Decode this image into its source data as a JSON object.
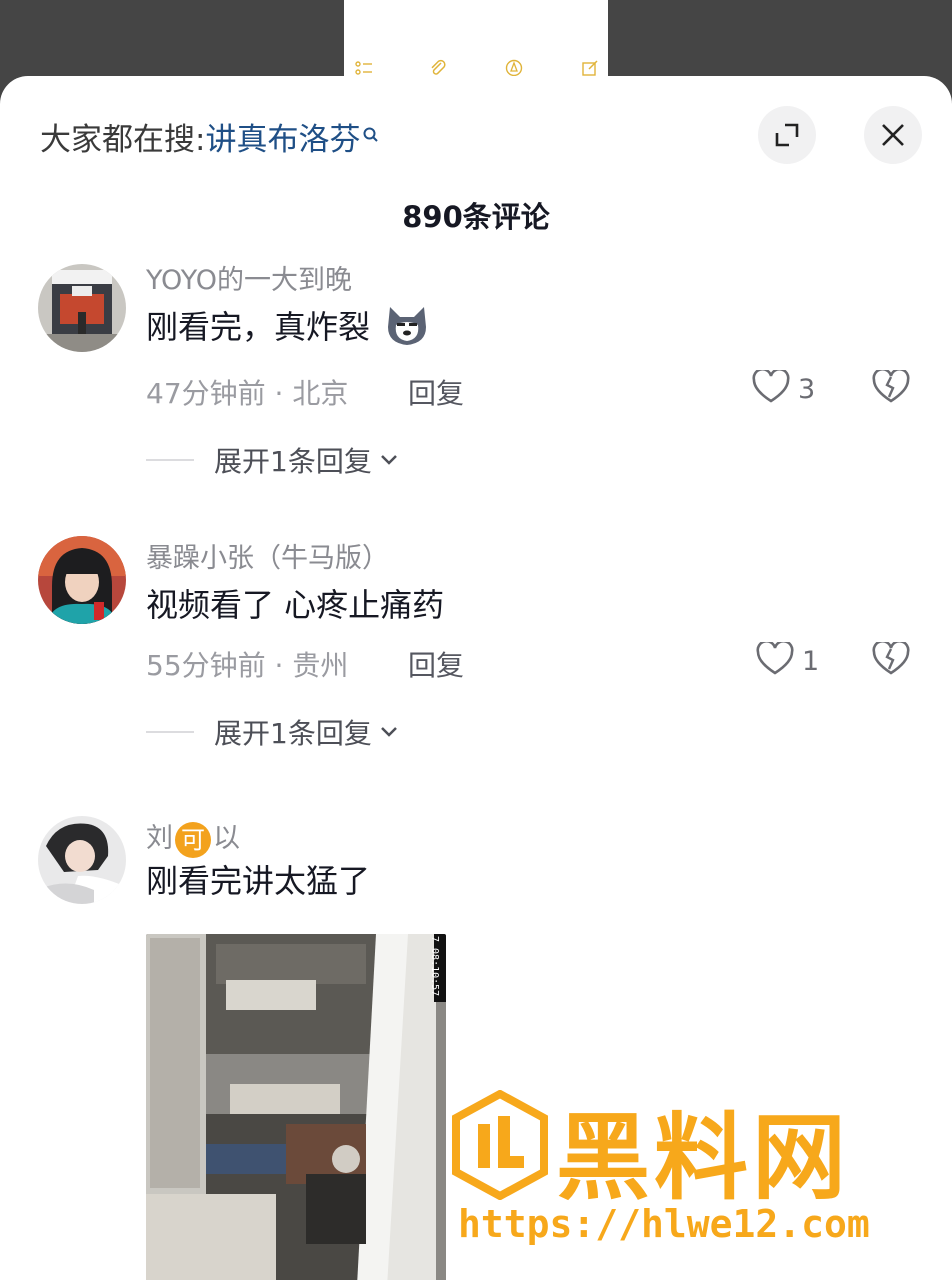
{
  "notes_toolbar": {
    "icons": [
      "checklist-icon",
      "paperclip-icon",
      "pen-icon",
      "compose-icon"
    ]
  },
  "header": {
    "search_prefix": "大家都在搜:",
    "search_keyword": "讲真布洛芬",
    "comment_count_title": "890条评论"
  },
  "comments": [
    {
      "username": "YOYO的一大到晚",
      "text": "刚看完，真炸裂",
      "emoji": "husky-emoji",
      "time_location": "47分钟前 · 北京",
      "reply_label": "回复",
      "like_count": "3",
      "expand_label": "展开1条回复"
    },
    {
      "username": "暴躁小张（牛马版）",
      "text": "视频看了 心疼止痛药",
      "time_location": "55分钟前 · 贵州",
      "reply_label": "回复",
      "like_count": "1",
      "expand_label": "展开1条回复"
    },
    {
      "username_pre": "刘",
      "username_badge": "可",
      "username_post": "以",
      "text": "刚看完讲太猛了",
      "image_timestamp": "7 08:10:57"
    }
  ],
  "watermark": {
    "title": "黑料网",
    "url": "https://hlwe12.com",
    "color": "#f7a81b"
  },
  "colors": {
    "keyword": "#1f4f86",
    "meta_gray": "#9a9ba1",
    "badge_orange": "#f3a21d"
  }
}
